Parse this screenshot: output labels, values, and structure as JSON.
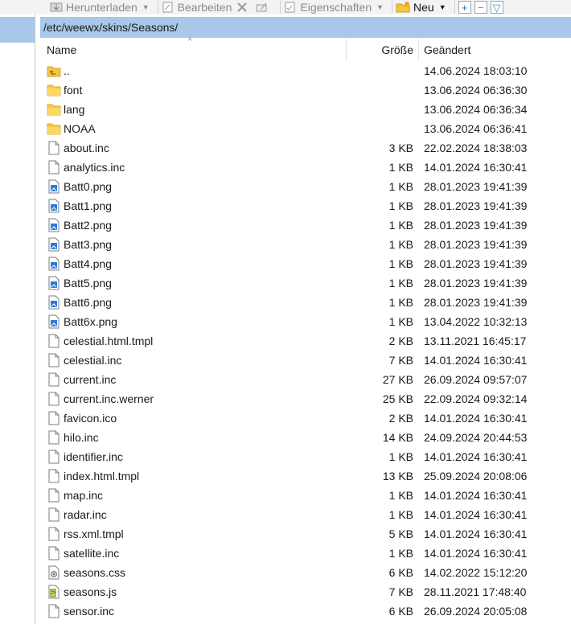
{
  "toolbar": {
    "download_label": "Herunterladen",
    "edit_label": "Bearbeiten",
    "properties_label": "Eigenschaften",
    "new_label": "Neu"
  },
  "path": "/etc/weewx/skins/Seasons/",
  "columns": {
    "name": "Name",
    "size": "Größe",
    "modified": "Geändert"
  },
  "files": [
    {
      "name": "..",
      "size": "",
      "modified": "14.06.2024 18:03:10",
      "icon": "parent-folder-icon"
    },
    {
      "name": "font",
      "size": "",
      "modified": "13.06.2024 06:36:30",
      "icon": "folder-icon"
    },
    {
      "name": "lang",
      "size": "",
      "modified": "13.06.2024 06:36:34",
      "icon": "folder-icon"
    },
    {
      "name": "NOAA",
      "size": "",
      "modified": "13.06.2024 06:36:41",
      "icon": "folder-icon"
    },
    {
      "name": "about.inc",
      "size": "3 KB",
      "modified": "22.02.2024 18:38:03",
      "icon": "file-icon"
    },
    {
      "name": "analytics.inc",
      "size": "1 KB",
      "modified": "14.01.2024 16:30:41",
      "icon": "file-icon"
    },
    {
      "name": "Batt0.png",
      "size": "1 KB",
      "modified": "28.01.2023 19:41:39",
      "icon": "image-file-icon"
    },
    {
      "name": "Batt1.png",
      "size": "1 KB",
      "modified": "28.01.2023 19:41:39",
      "icon": "image-file-icon"
    },
    {
      "name": "Batt2.png",
      "size": "1 KB",
      "modified": "28.01.2023 19:41:39",
      "icon": "image-file-icon"
    },
    {
      "name": "Batt3.png",
      "size": "1 KB",
      "modified": "28.01.2023 19:41:39",
      "icon": "image-file-icon"
    },
    {
      "name": "Batt4.png",
      "size": "1 KB",
      "modified": "28.01.2023 19:41:39",
      "icon": "image-file-icon"
    },
    {
      "name": "Batt5.png",
      "size": "1 KB",
      "modified": "28.01.2023 19:41:39",
      "icon": "image-file-icon"
    },
    {
      "name": "Batt6.png",
      "size": "1 KB",
      "modified": "28.01.2023 19:41:39",
      "icon": "image-file-icon"
    },
    {
      "name": "Batt6x.png",
      "size": "1 KB",
      "modified": "13.04.2022 10:32:13",
      "icon": "image-file-icon"
    },
    {
      "name": "celestial.html.tmpl",
      "size": "2 KB",
      "modified": "13.11.2021 16:45:17",
      "icon": "file-icon"
    },
    {
      "name": "celestial.inc",
      "size": "7 KB",
      "modified": "14.01.2024 16:30:41",
      "icon": "file-icon"
    },
    {
      "name": "current.inc",
      "size": "27 KB",
      "modified": "26.09.2024 09:57:07",
      "icon": "file-icon"
    },
    {
      "name": "current.inc.werner",
      "size": "25 KB",
      "modified": "22.09.2024 09:32:14",
      "icon": "file-icon"
    },
    {
      "name": "favicon.ico",
      "size": "2 KB",
      "modified": "14.01.2024 16:30:41",
      "icon": "file-icon"
    },
    {
      "name": "hilo.inc",
      "size": "14 KB",
      "modified": "24.09.2024 20:44:53",
      "icon": "file-icon"
    },
    {
      "name": "identifier.inc",
      "size": "1 KB",
      "modified": "14.01.2024 16:30:41",
      "icon": "file-icon"
    },
    {
      "name": "index.html.tmpl",
      "size": "13 KB",
      "modified": "25.09.2024 20:08:06",
      "icon": "file-icon"
    },
    {
      "name": "map.inc",
      "size": "1 KB",
      "modified": "14.01.2024 16:30:41",
      "icon": "file-icon"
    },
    {
      "name": "radar.inc",
      "size": "1 KB",
      "modified": "14.01.2024 16:30:41",
      "icon": "file-icon"
    },
    {
      "name": "rss.xml.tmpl",
      "size": "5 KB",
      "modified": "14.01.2024 16:30:41",
      "icon": "file-icon"
    },
    {
      "name": "satellite.inc",
      "size": "1 KB",
      "modified": "14.01.2024 16:30:41",
      "icon": "file-icon"
    },
    {
      "name": "seasons.css",
      "size": "6 KB",
      "modified": "14.02.2022 15:12:20",
      "icon": "css-file-icon"
    },
    {
      "name": "seasons.js",
      "size": "7 KB",
      "modified": "28.11.2021 17:48:40",
      "icon": "js-file-icon"
    },
    {
      "name": "sensor.inc",
      "size": "6 KB",
      "modified": "26.09.2024 20:05:08",
      "icon": "file-icon"
    }
  ]
}
